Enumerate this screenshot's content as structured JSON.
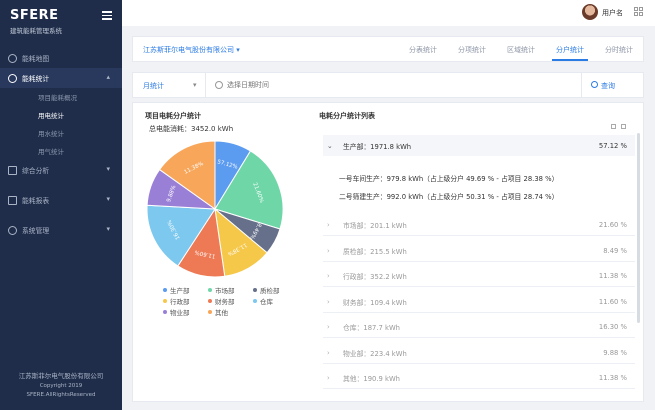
{
  "sidebar": {
    "brand": "SFERE",
    "brand_sub": "建筑能耗管理系统",
    "menu": [
      {
        "label": "能耗地图"
      },
      {
        "label": "能耗统计",
        "caret": "▴"
      },
      {
        "label": "综合分析",
        "caret": "▾"
      },
      {
        "label": "能耗报表",
        "caret": "▾"
      },
      {
        "label": "系统管理",
        "caret": "▾"
      }
    ],
    "sub": [
      "项目能耗概况",
      "用电统计",
      "用水统计",
      "用气统计"
    ],
    "footer": [
      "江苏斯菲尔电气股份有限公司",
      "Copyright 2019",
      "SFERE.AllRightsReserved"
    ]
  },
  "topbar": {
    "username": "用户名"
  },
  "tabbar": {
    "company": "江苏斯菲尔电气股份有限公司 ▾",
    "tabs": [
      "分表统计",
      "分项统计",
      "区域统计",
      "分户统计",
      "分时统计"
    ]
  },
  "filter": {
    "period": "月统计",
    "date_placeholder": "选择日期时间",
    "query": "查询"
  },
  "panel": {
    "pie_title": "项目电耗分户统计",
    "total": "总电能消耗：3452.0 kWh",
    "list_title": "电耗分户统计列表"
  },
  "chart_data": {
    "type": "pie",
    "title": "项目电耗分户统计",
    "slices": [
      {
        "name": "生产部",
        "label": "57.12%",
        "value": 1971.8,
        "color": "#5b9bf0"
      },
      {
        "name": "市场部",
        "label": "21.60%",
        "value": 201.1,
        "color": "#6fd6a8"
      },
      {
        "name": "质检部",
        "label": "8.49%",
        "value": 215.5,
        "color": "#66708a"
      },
      {
        "name": "行政部",
        "label": "11.38%",
        "value": 352.2,
        "color": "#f5c84a"
      },
      {
        "name": "财务部",
        "label": "11.60%",
        "value": 109.4,
        "color": "#ee7a55"
      },
      {
        "name": "仓库",
        "label": "16.30%",
        "value": 187.7,
        "color": "#7cc8ee"
      },
      {
        "name": "物业部",
        "label": "9.88%",
        "value": 223.4,
        "color": "#9a7fd6"
      },
      {
        "name": "其他",
        "label": "11.38%",
        "value": 190.9,
        "color": "#f7a65a"
      }
    ],
    "fractions": [
      0.0873,
      0.2102,
      0.0637,
      0.1159,
      0.1149,
      0.1667,
      0.0897,
      0.1516
    ]
  },
  "list": {
    "head": {
      "label": "生产部：1971.8 kWh",
      "pct": "57.12 %"
    },
    "details": [
      "一号车间生产：979.8 kWh（占上级分户 49.69 % - 占项目 28.38 %）",
      "二号筛建生产：992.0 kWh（占上级分户 50.31 % - 占项目 28.74 %）"
    ],
    "rows": [
      {
        "label": "市场部：201.1 kWh",
        "pct": "21.60 %"
      },
      {
        "label": "质检部：215.5 kWh",
        "pct": "8.49 %"
      },
      {
        "label": "行政部：352.2 kWh",
        "pct": "11.38 %"
      },
      {
        "label": "财务部：109.4 kWh",
        "pct": "11.60 %"
      },
      {
        "label": "仓库：187.7 kWh",
        "pct": "16.30 %"
      },
      {
        "label": "物业部：223.4 kWh",
        "pct": "9.88 %"
      },
      {
        "label": "其他：190.9 kWh",
        "pct": "11.38 %"
      }
    ]
  }
}
